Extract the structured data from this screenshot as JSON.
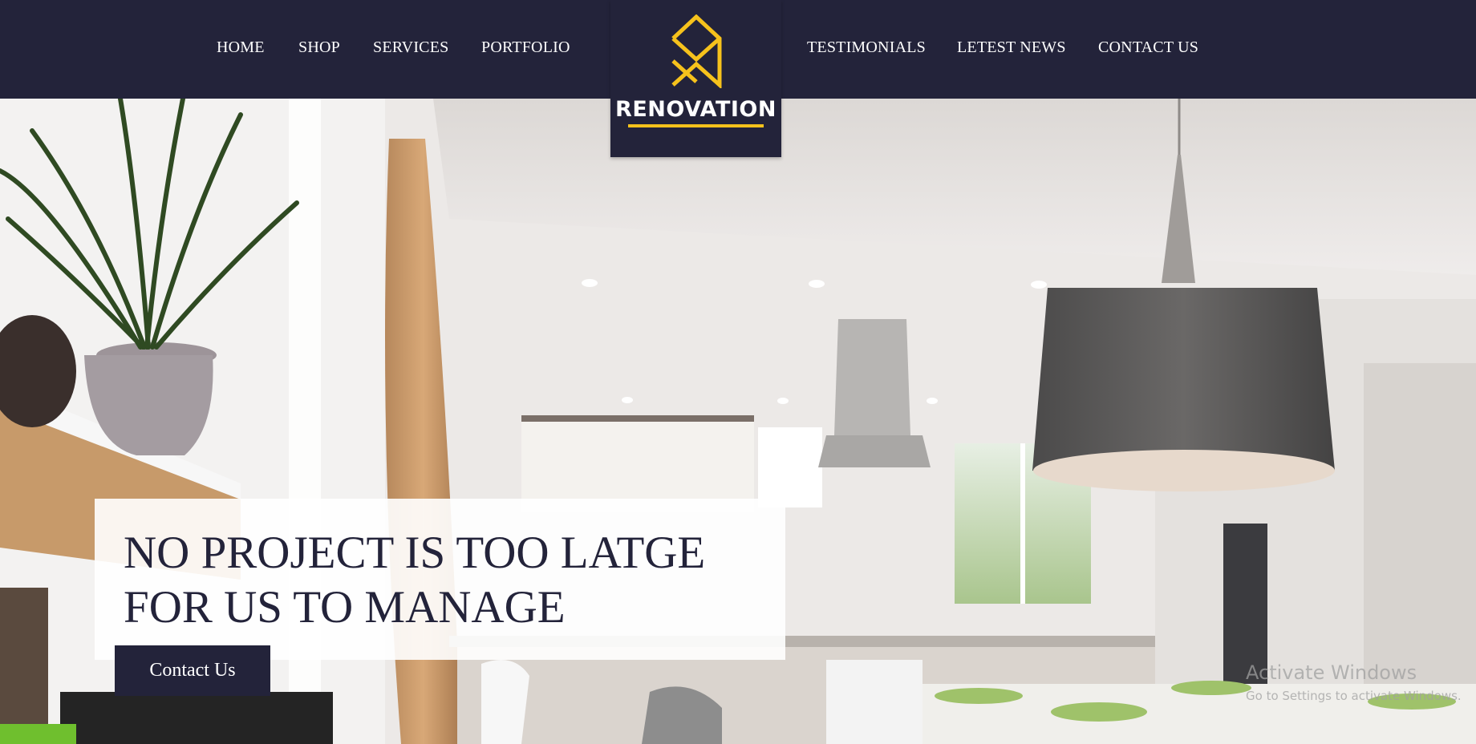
{
  "nav": {
    "left": [
      "HOME",
      "SHOP",
      "SERVICES",
      "PORTFOLIO"
    ],
    "right": [
      "TESTIMONIALS",
      "LETEST NEWS",
      "CONTACT US"
    ]
  },
  "logo": {
    "text": "RENOVATION",
    "accent_color": "#f6c21c"
  },
  "hero": {
    "headline_line1": "NO PROJECT IS TOO LATGE",
    "headline_line2": "FOR US TO MANAGE",
    "cta_label": "Contact Us"
  },
  "watermark": {
    "title": "Activate Windows",
    "subtitle": "Go to Settings to activate Windows."
  },
  "colors": {
    "navbar": "#23233a",
    "accent": "#f6c21c",
    "text_dark": "#23233a"
  }
}
